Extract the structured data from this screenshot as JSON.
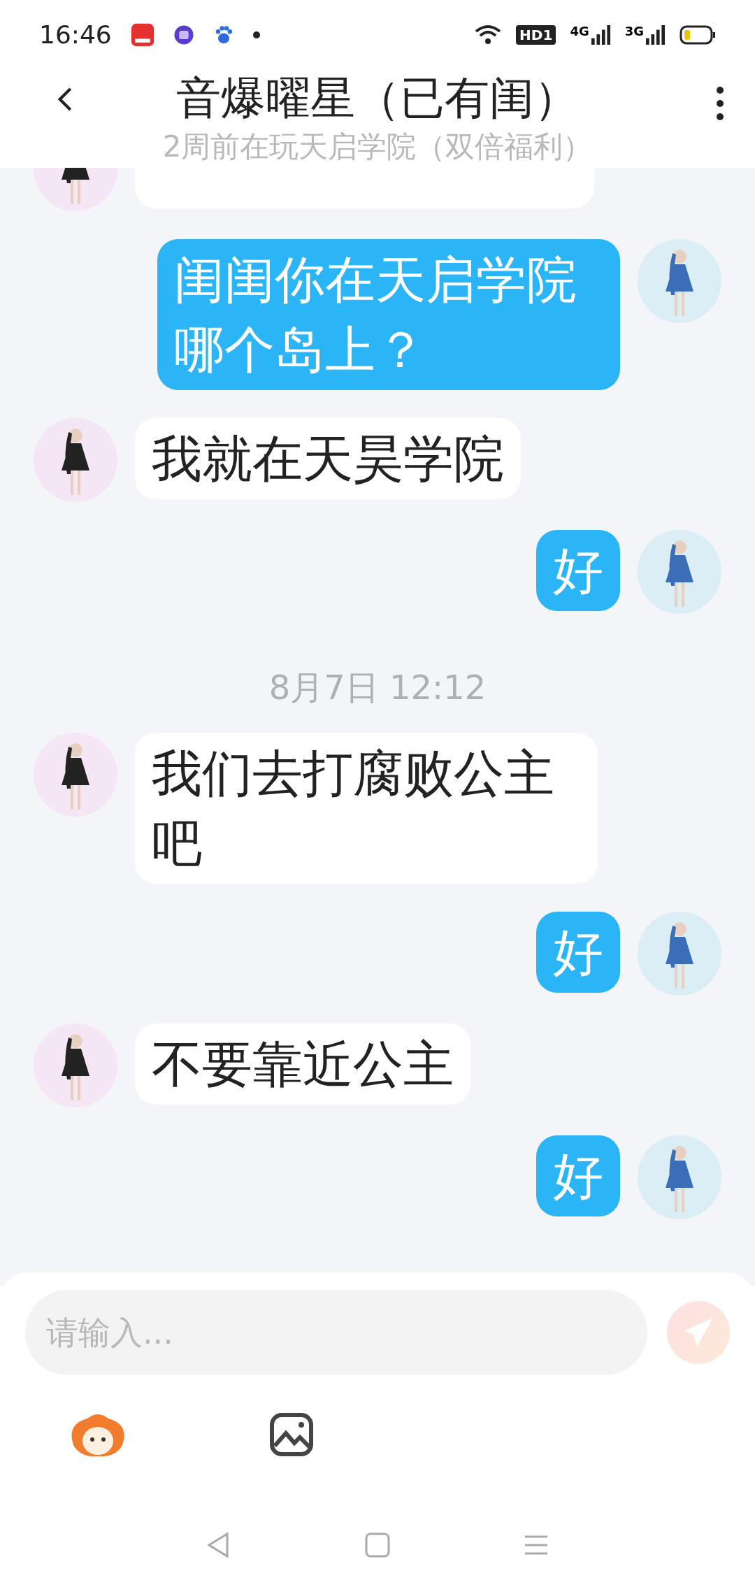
{
  "status_bar": {
    "time": "16:46",
    "badge": "HD1",
    "network_1": "4G",
    "network_2": "3G"
  },
  "header": {
    "title": "音爆曜星（已有闺）",
    "subtitle": "2周前在玩天启学院（双倍福利）"
  },
  "messages": [
    {
      "kind": "incoming"
    },
    {
      "kind": "outgoing",
      "text": "闺闺你在天启学院哪个岛上？"
    },
    {
      "kind": "incoming",
      "text": "我就在天昊学院"
    },
    {
      "kind": "outgoing",
      "text": "好"
    },
    {
      "kind": "time",
      "text": "8月7日 12:12"
    },
    {
      "kind": "incoming",
      "text": "我们去打腐败公主吧"
    },
    {
      "kind": "outgoing",
      "text": "好"
    },
    {
      "kind": "incoming",
      "text": "不要靠近公主"
    },
    {
      "kind": "outgoing",
      "text": "好"
    }
  ],
  "composer": {
    "placeholder": "请输入..."
  }
}
